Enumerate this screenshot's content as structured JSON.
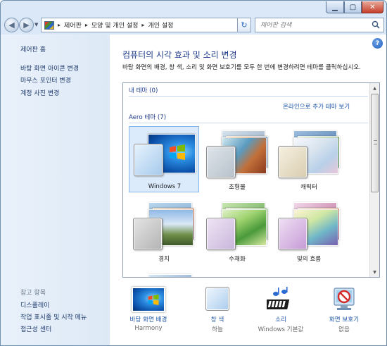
{
  "window": {
    "buttons": {
      "minimize": "▁",
      "maximize": "▢",
      "close": "✕"
    }
  },
  "nav": {
    "back_icon": "back-arrow-icon",
    "forward_icon": "forward-arrow-icon",
    "breadcrumbs": [
      "제어판",
      "모양 및 개인 설정",
      "개인 설정"
    ],
    "search_placeholder": "제어판 검색"
  },
  "sidebar": {
    "home": "제어판 홈",
    "links": [
      "바탕 화면 아이콘 변경",
      "마우스 포인터 변경",
      "계정 사진 변경"
    ],
    "see_also": "참고 항목",
    "see_also_links": [
      "디스플레이",
      "작업 표시줄 및 시작 메뉴",
      "접근성 센터"
    ]
  },
  "main": {
    "title": "컴퓨터의 시각 효과 및 소리 변경",
    "description": "바탕 화면의 배경, 창 색, 소리 및 화면 보호기를 모두 한 번에 변경하려면 테마를 클릭하십시오.",
    "my_themes_header": "내 테마 (0)",
    "online_link": "온라인으로 추가 테마 보기",
    "aero_header": "Aero 테마 (7)",
    "themes": [
      {
        "name": "Windows 7",
        "selected": true
      },
      {
        "name": "조형물",
        "selected": false
      },
      {
        "name": "캐릭터",
        "selected": false
      },
      {
        "name": "경치",
        "selected": false
      },
      {
        "name": "수채화",
        "selected": false
      },
      {
        "name": "빛의 흐름",
        "selected": false
      }
    ]
  },
  "bottom": {
    "items": [
      {
        "label": "바탕 화면 배경",
        "value": "Harmony"
      },
      {
        "label": "창 색",
        "value": "하늘"
      },
      {
        "label": "소리",
        "value": "Windows 기본값"
      },
      {
        "label": "화면 보호기",
        "value": "없음"
      }
    ]
  },
  "colors": {
    "link": "#1e56a8",
    "title": "#1e3a8a",
    "selection": "#dcebfc"
  }
}
